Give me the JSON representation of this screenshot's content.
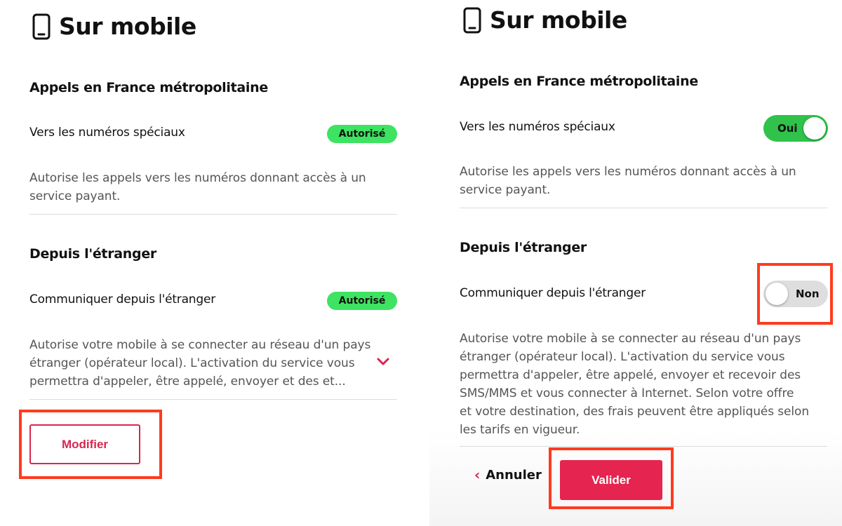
{
  "colors": {
    "accent": "#e5244f",
    "badge_green": "#3ee361",
    "toggle_on": "#30c24a",
    "toggle_off": "#dedede",
    "highlight": "#ff3b1f"
  },
  "left": {
    "title": "Sur mobile",
    "section1": {
      "heading": "Appels en France métropolitaine",
      "row_label": "Vers les numéros spéciaux",
      "badge": "Autorisé",
      "desc_line1": "Autorise les appels vers les numéros donnant accès à un",
      "desc_line2": "service payant."
    },
    "section2": {
      "heading": "Depuis l'étranger",
      "row_label": "Communiquer depuis l'étranger",
      "badge": "Autorisé",
      "desc_line1": "Autorise votre mobile à se connecter au réseau d'un pays",
      "desc_line2": "étranger (opérateur local). L'activation du service vous",
      "desc_line3": "permettra d'appeler, être appelé, envoyer et des et..."
    },
    "modify_button": "Modifier"
  },
  "right": {
    "title": "Sur mobile",
    "section1": {
      "heading": "Appels en France métropolitaine",
      "row_label": "Vers les numéros spéciaux",
      "toggle_label": "Oui",
      "desc_line1": "Autorise les appels vers les numéros donnant accès à un",
      "desc_line2": "service payant."
    },
    "section2": {
      "heading": "Depuis l'étranger",
      "row_label": "Communiquer depuis l'étranger",
      "toggle_label": "Non",
      "desc_lines": [
        "Autorise votre mobile à se connecter au réseau d'un pays",
        "étranger (opérateur local). L'activation du service vous",
        "permettra d'appeler, être appelé, envoyer et recevoir des",
        "SMS/MMS et vous connecter à Internet. Selon votre offre",
        "et votre destination, des frais peuvent être appliqués selon",
        "les tarifs en vigueur."
      ]
    },
    "cancel_link": "Annuler",
    "validate_button": "Valider"
  }
}
